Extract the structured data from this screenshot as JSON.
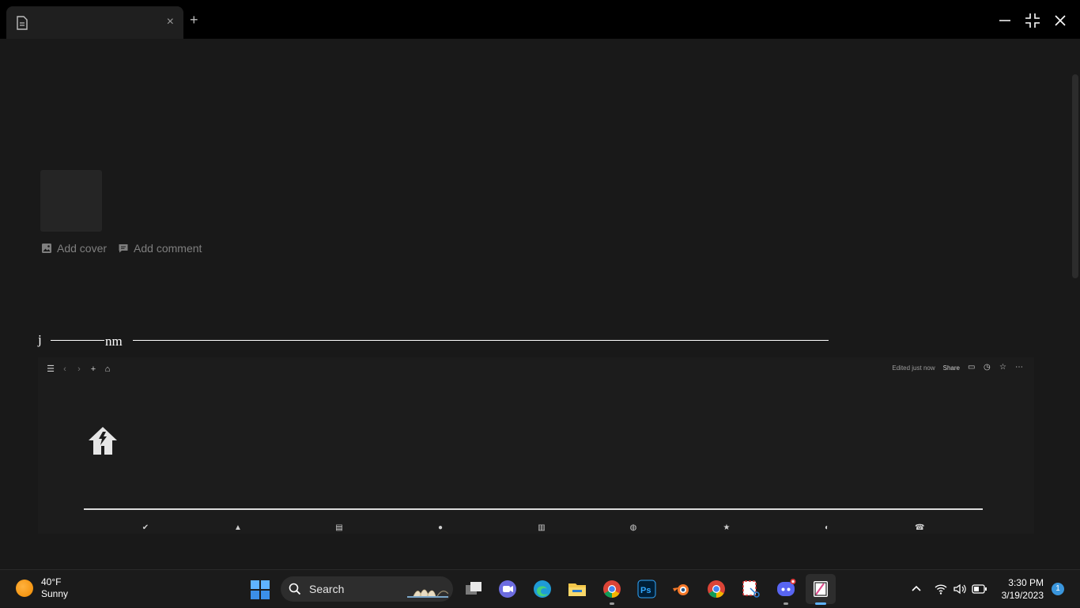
{
  "window": {
    "tab_close": "×",
    "new_tab": "+"
  },
  "page": {
    "actions": {
      "add_cover": "Add cover",
      "add_comment": "Add comment"
    },
    "title_j": "j",
    "title_nm": "nm"
  },
  "embed": {
    "status": "Edited just now",
    "share": "Share"
  },
  "taskbar": {
    "weather": {
      "temp": "40°F",
      "condition": "Sunny"
    },
    "search_label": "Search",
    "time": "3:30 PM",
    "date": "3/19/2023",
    "notification_count": "1"
  }
}
